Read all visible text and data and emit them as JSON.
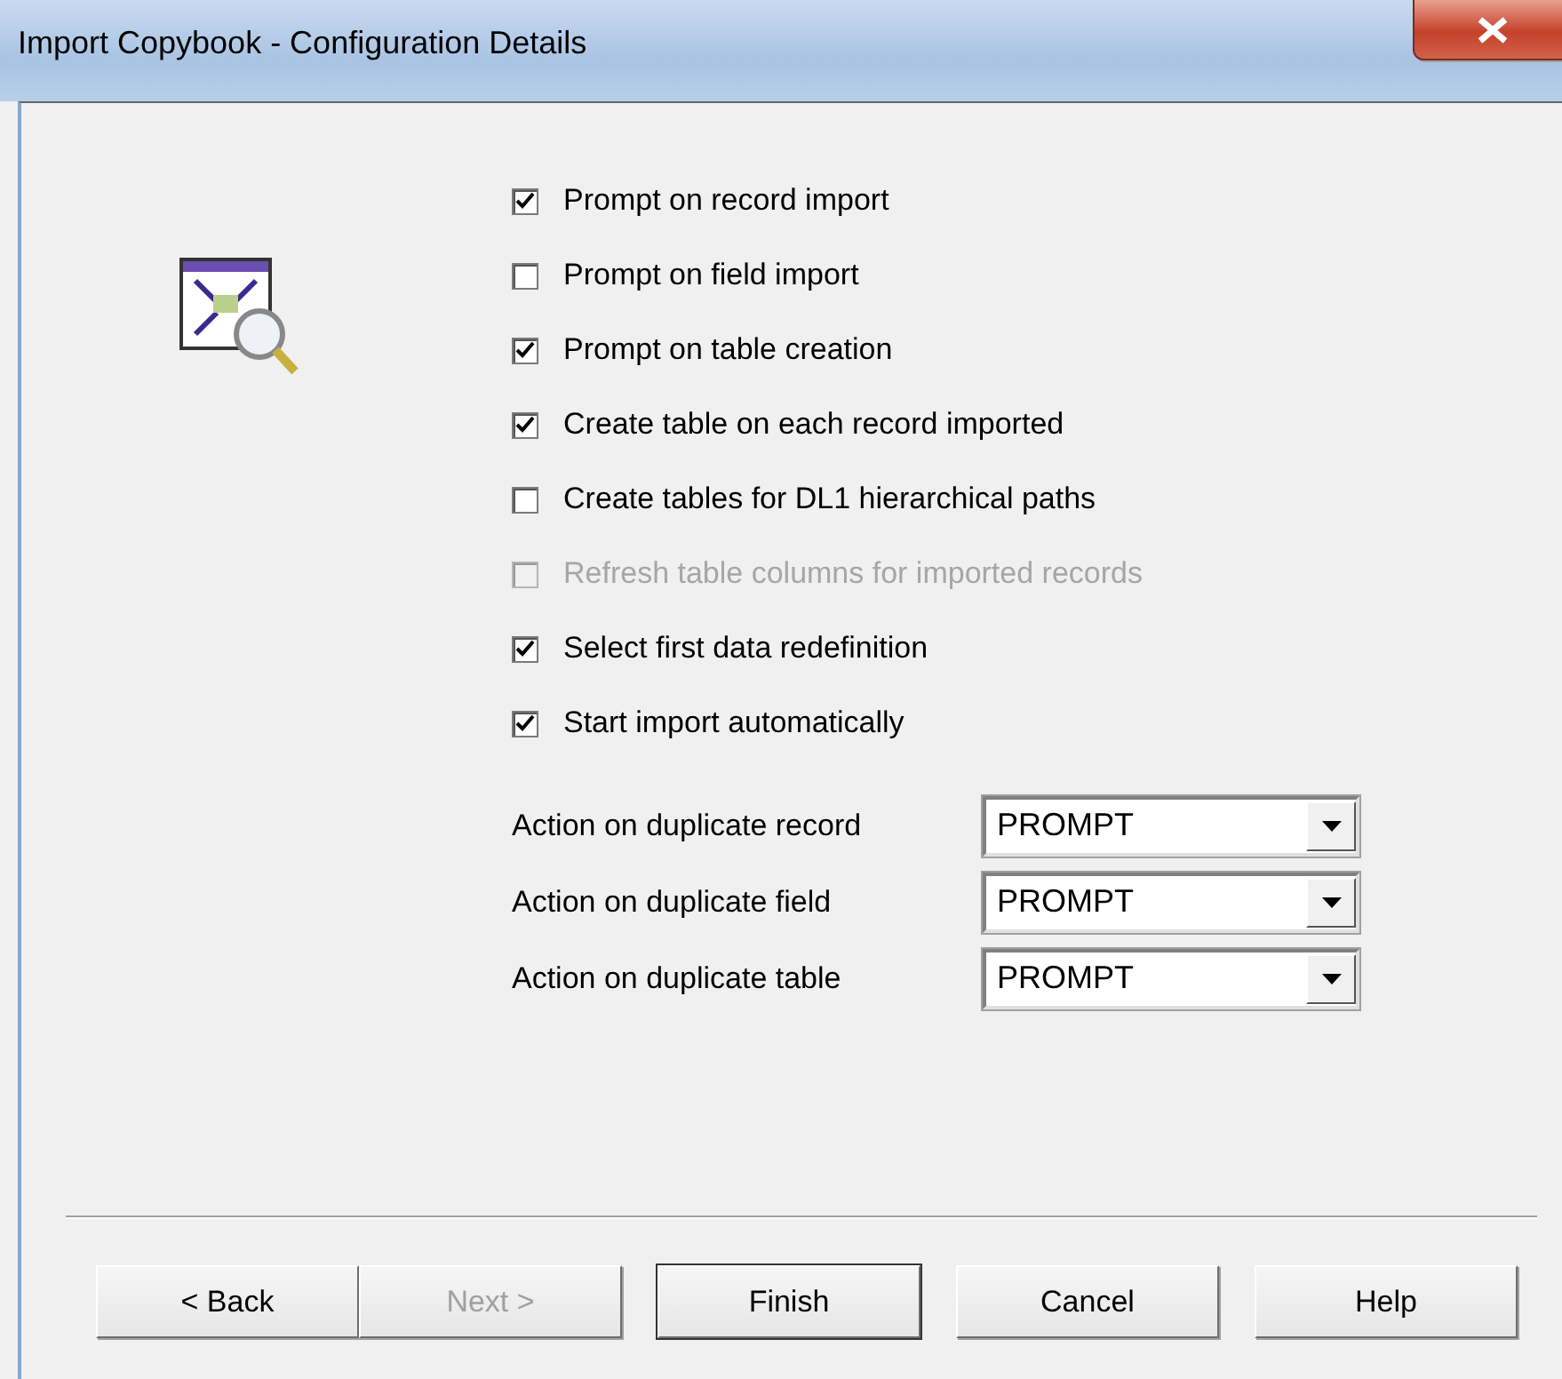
{
  "window": {
    "title": "Import Copybook - Configuration  Details"
  },
  "options": [
    {
      "label": "Prompt on record import",
      "checked": true,
      "disabled": false
    },
    {
      "label": "Prompt on field import",
      "checked": false,
      "disabled": false
    },
    {
      "label": "Prompt on table creation",
      "checked": true,
      "disabled": false
    },
    {
      "label": "Create table on each record imported",
      "checked": true,
      "disabled": false
    },
    {
      "label": "Create tables for DL1 hierarchical paths",
      "checked": false,
      "disabled": false
    },
    {
      "label": "Refresh table columns for imported records",
      "checked": false,
      "disabled": true
    },
    {
      "label": "Select first data redefinition",
      "checked": true,
      "disabled": false
    },
    {
      "label": "Start import automatically",
      "checked": true,
      "disabled": false
    }
  ],
  "actions": [
    {
      "label": "Action on duplicate record",
      "value": "PROMPT"
    },
    {
      "label": "Action on duplicate field",
      "value": "PROMPT"
    },
    {
      "label": "Action on duplicate table",
      "value": "PROMPT"
    }
  ],
  "buttons": [
    {
      "label": "< Back",
      "disabled": false,
      "default": false
    },
    {
      "label": "Next >",
      "disabled": true,
      "default": false
    },
    {
      "label": "Finish",
      "disabled": false,
      "default": true
    },
    {
      "label": "Cancel",
      "disabled": false,
      "default": false
    },
    {
      "label": "Help",
      "disabled": false,
      "default": false
    }
  ]
}
